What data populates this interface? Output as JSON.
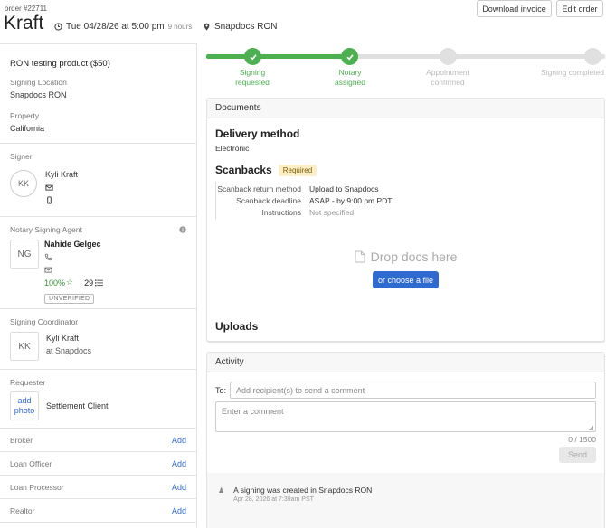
{
  "header": {
    "order_number": "order #22711",
    "title": "Kraft",
    "datetime": "Tue 04/28/26 at 5:00 pm",
    "time_until": "9 hours",
    "location": "Snapdocs RON",
    "download_invoice": "Download invoice",
    "edit_order": "Edit order"
  },
  "sidebar": {
    "product": "RON testing product ($50)",
    "signing_location_label": "Signing Location",
    "signing_location": "Snapdocs RON",
    "property_label": "Property",
    "property": "California",
    "signer_label": "Signer",
    "signer_initials": "KK",
    "signer_name": "Kyli Kraft",
    "nsa_label": "Notary Signing Agent",
    "nsa_initials": "NG",
    "nsa_name": "Nahide Gelgec",
    "nsa_rating": "100%",
    "nsa_count": "29",
    "nsa_status": "UNVERIFIED",
    "coordinator_label": "Signing Coordinator",
    "coordinator_initials": "KK",
    "coordinator_name": "Kyli Kraft",
    "coordinator_company": "at Snapdocs",
    "requester_label": "Requester",
    "add_photo_1": "add",
    "add_photo_2": "photo",
    "requester_name": "Settlement Client",
    "roles": [
      {
        "label": "Broker",
        "action": "Add"
      },
      {
        "label": "Loan Officer",
        "action": "Add"
      },
      {
        "label": "Loan Processor",
        "action": "Add"
      },
      {
        "label": "Realtor",
        "action": "Add"
      }
    ]
  },
  "progress": {
    "steps": [
      {
        "line1": "Signing",
        "line2": "requested",
        "done": true
      },
      {
        "line1": "Notary",
        "line2": "assigned",
        "done": true
      },
      {
        "line1": "Appointment",
        "line2": "confirmed",
        "done": false
      },
      {
        "line1": "Signing completed",
        "line2": "",
        "done": false
      }
    ]
  },
  "documents": {
    "title": "Documents",
    "delivery_heading": "Delivery method",
    "delivery_value": "Electronic",
    "scanbacks_heading": "Scanbacks",
    "required_badge": "Required",
    "return_method_key": "Scanback return method",
    "return_method_val": "Upload to Snapdocs",
    "deadline_key": "Scanback deadline",
    "deadline_val": "ASAP - by 9:00 pm PDT",
    "instructions_key": "Instructions",
    "instructions_val": "Not specified",
    "drop_text": "Drop docs here",
    "choose_file": "or choose a file",
    "uploads_heading": "Uploads"
  },
  "activity": {
    "title": "Activity",
    "to_label": "To:",
    "recipient_placeholder": "Add recipient(s) to send a comment",
    "comment_placeholder": "Enter a comment",
    "char_count": "0 / 1500",
    "send": "Send",
    "entries": [
      {
        "text": "A signing was created in Snapdocs RON",
        "time": "Apr 28, 2026 at 7:39am PST"
      }
    ]
  },
  "colors": {
    "green": "#4caf50",
    "blue": "#2f6ad0",
    "grey_track": "#e0e0e0"
  }
}
